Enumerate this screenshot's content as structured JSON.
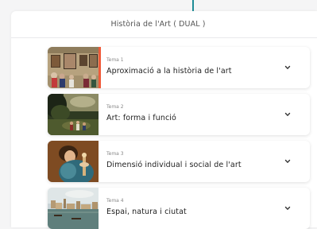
{
  "page": {
    "course_title": "Història de l'Art ( DUAL )"
  },
  "colors": {
    "accent": "#ef5a3a",
    "top_line": "#1f8d97"
  },
  "topics": [
    {
      "label": "Tema 1",
      "title": "Aproximació a la història de l'art",
      "expand_icon": "chevron-down-icon",
      "selected": true
    },
    {
      "label": "Tema 2",
      "title": "Art: forma i funció",
      "expand_icon": "chevron-down-icon",
      "selected": false
    },
    {
      "label": "Tema 3",
      "title": "Dimensió individual i social de l'art",
      "expand_icon": "chevron-down-icon",
      "selected": false
    },
    {
      "label": "Tema 4",
      "title": "Espai, natura i ciutat",
      "expand_icon": "chevron-down-icon",
      "selected": false
    }
  ]
}
